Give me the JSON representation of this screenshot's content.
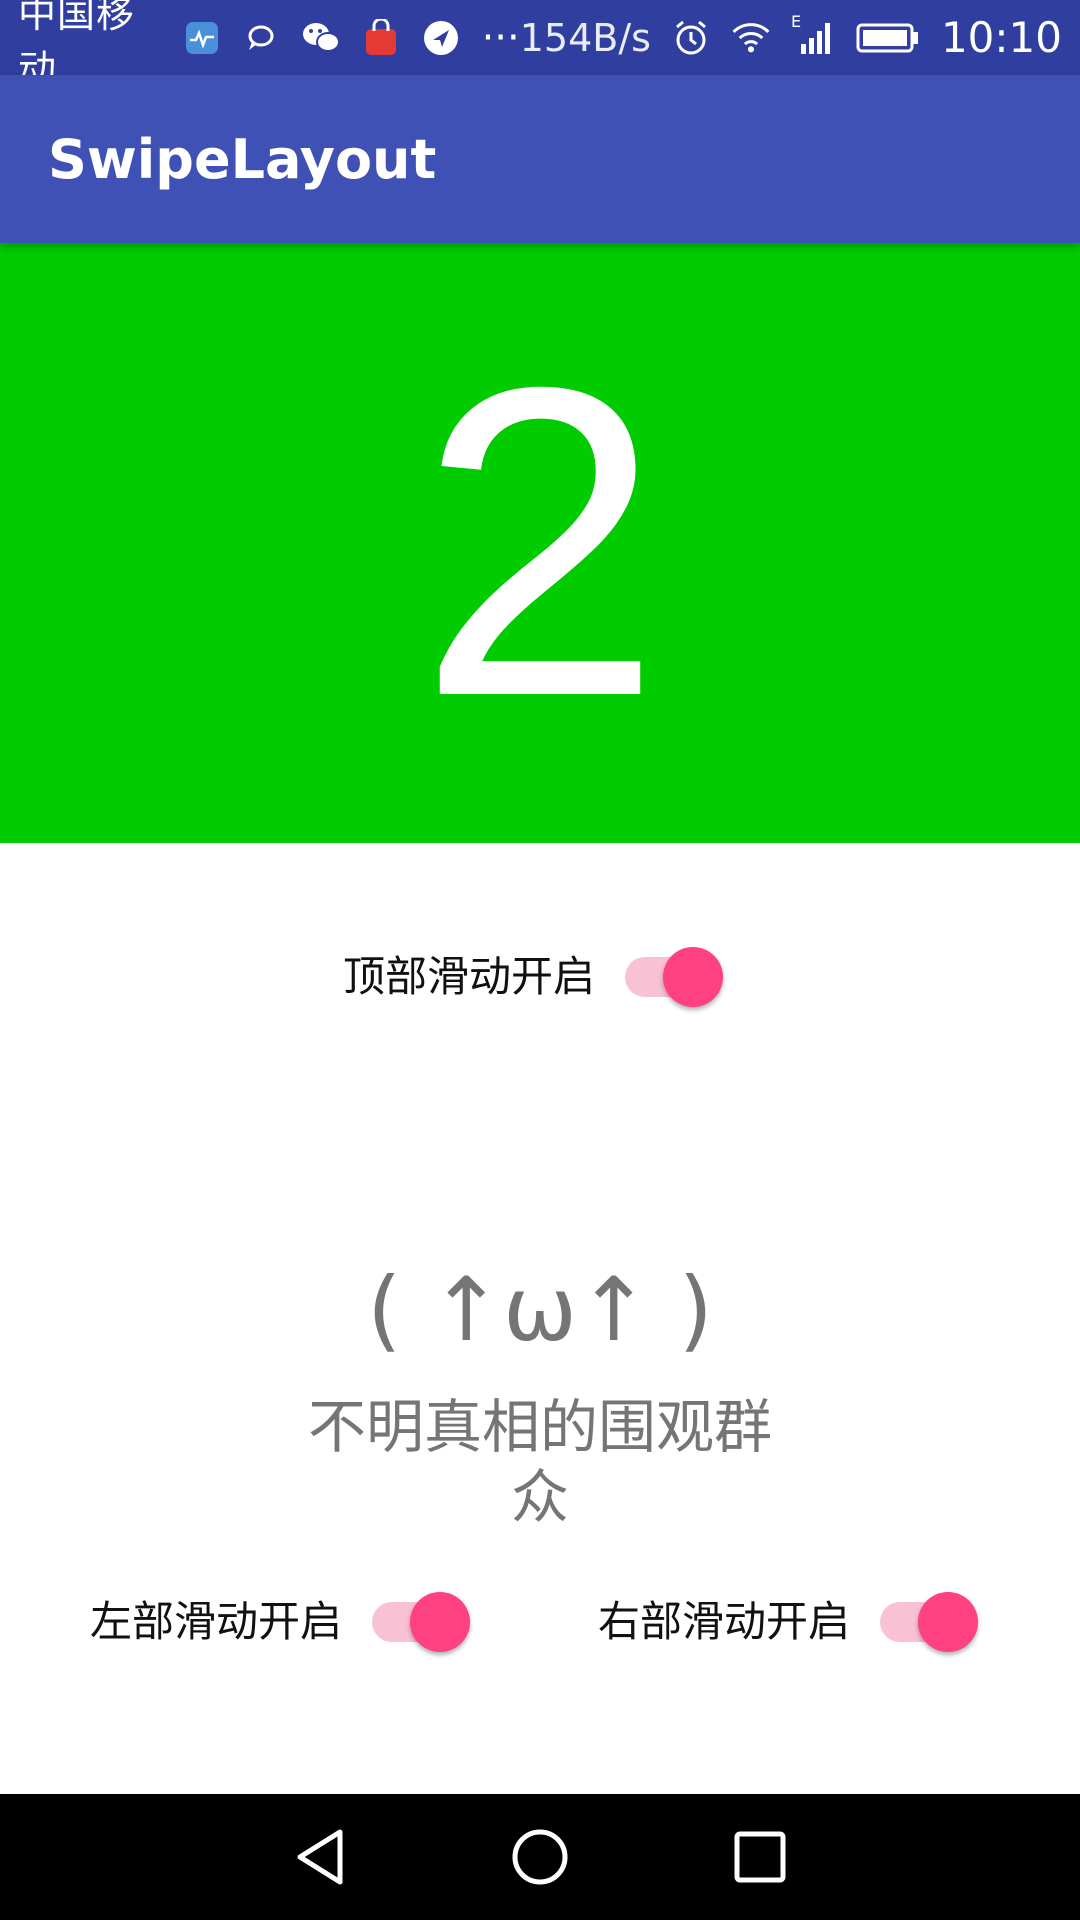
{
  "status_bar": {
    "carrier": "中国移动",
    "more": "···",
    "net_speed": "154B/s",
    "network_type": "E",
    "time": "10:10",
    "icons": [
      "health-app-icon",
      "chat-bubble-icon",
      "wechat-icon",
      "shopping-bag-icon",
      "direction-app-icon",
      "alarm-icon",
      "wifi-icon",
      "signal-icon",
      "battery-icon"
    ]
  },
  "app_bar": {
    "title": "SwipeLayout"
  },
  "panel": {
    "number": "2",
    "background": "#00CC00"
  },
  "switches": {
    "top": {
      "label": "顶部滑动开启",
      "checked": true
    },
    "left": {
      "label": "左部滑动开启",
      "checked": true
    },
    "right": {
      "label": "右部滑动开启",
      "checked": true
    }
  },
  "center": {
    "emoticon": "( ↑ω↑ )",
    "caption": "不明真相的围观群众"
  },
  "nav_bar": {
    "buttons": [
      "back-icon",
      "home-icon",
      "recents-icon"
    ]
  },
  "colors": {
    "status_bar": "#303F9F",
    "app_bar": "#3F51B5",
    "accent": "#FF4081"
  }
}
